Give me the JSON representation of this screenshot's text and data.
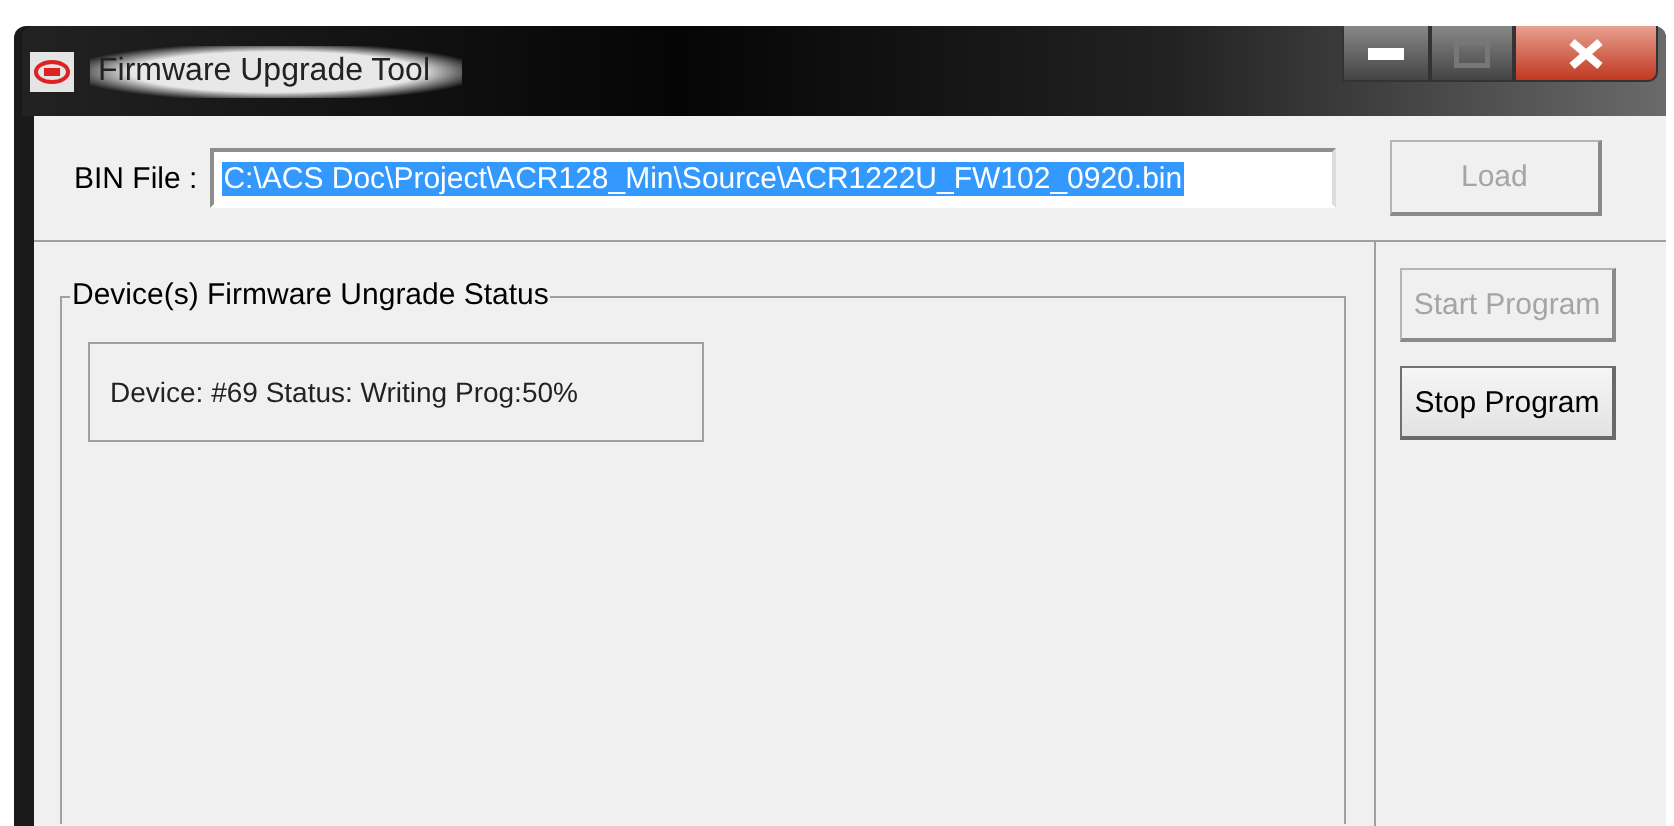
{
  "window": {
    "title": "Firmware Upgrade Tool",
    "maximize_disabled": true
  },
  "bin_file": {
    "label": "BIN File :",
    "value": "C:\\ACS Doc\\Project\\ACR128_Min\\Source\\ACR1222U_FW102_0920.bin",
    "selected": true
  },
  "load_button": {
    "label": "Load",
    "disabled": true
  },
  "status_group": {
    "title": "Device(s) Firmware Ungrade Status",
    "devices": [
      {
        "text": "Device: #69 Status: Writing Prog:50%"
      }
    ]
  },
  "buttons": [
    {
      "label": "Start Program",
      "disabled": true
    },
    {
      "label": "Stop Program",
      "disabled": false
    }
  ]
}
